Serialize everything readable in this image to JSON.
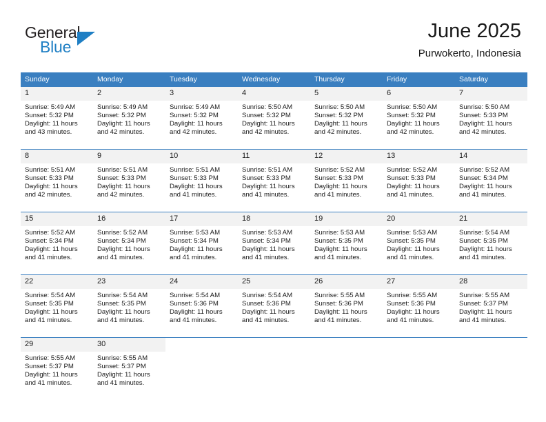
{
  "brand": {
    "line1": "General",
    "line2": "Blue",
    "flag_icon": "triangle-flag-icon",
    "accent_color": "#1f7fc4"
  },
  "header": {
    "title": "June 2025",
    "location": "Purwokerto, Indonesia"
  },
  "calendar": {
    "header_bg": "#3a7fc0",
    "daynum_bg": "#f2f2f2",
    "weekday_headers": [
      "Sunday",
      "Monday",
      "Tuesday",
      "Wednesday",
      "Thursday",
      "Friday",
      "Saturday"
    ],
    "weeks": [
      [
        {
          "day": "1",
          "sunrise": "Sunrise: 5:49 AM",
          "sunset": "Sunset: 5:32 PM",
          "daylight1": "Daylight: 11 hours",
          "daylight2": "and 43 minutes."
        },
        {
          "day": "2",
          "sunrise": "Sunrise: 5:49 AM",
          "sunset": "Sunset: 5:32 PM",
          "daylight1": "Daylight: 11 hours",
          "daylight2": "and 42 minutes."
        },
        {
          "day": "3",
          "sunrise": "Sunrise: 5:49 AM",
          "sunset": "Sunset: 5:32 PM",
          "daylight1": "Daylight: 11 hours",
          "daylight2": "and 42 minutes."
        },
        {
          "day": "4",
          "sunrise": "Sunrise: 5:50 AM",
          "sunset": "Sunset: 5:32 PM",
          "daylight1": "Daylight: 11 hours",
          "daylight2": "and 42 minutes."
        },
        {
          "day": "5",
          "sunrise": "Sunrise: 5:50 AM",
          "sunset": "Sunset: 5:32 PM",
          "daylight1": "Daylight: 11 hours",
          "daylight2": "and 42 minutes."
        },
        {
          "day": "6",
          "sunrise": "Sunrise: 5:50 AM",
          "sunset": "Sunset: 5:32 PM",
          "daylight1": "Daylight: 11 hours",
          "daylight2": "and 42 minutes."
        },
        {
          "day": "7",
          "sunrise": "Sunrise: 5:50 AM",
          "sunset": "Sunset: 5:33 PM",
          "daylight1": "Daylight: 11 hours",
          "daylight2": "and 42 minutes."
        }
      ],
      [
        {
          "day": "8",
          "sunrise": "Sunrise: 5:51 AM",
          "sunset": "Sunset: 5:33 PM",
          "daylight1": "Daylight: 11 hours",
          "daylight2": "and 42 minutes."
        },
        {
          "day": "9",
          "sunrise": "Sunrise: 5:51 AM",
          "sunset": "Sunset: 5:33 PM",
          "daylight1": "Daylight: 11 hours",
          "daylight2": "and 42 minutes."
        },
        {
          "day": "10",
          "sunrise": "Sunrise: 5:51 AM",
          "sunset": "Sunset: 5:33 PM",
          "daylight1": "Daylight: 11 hours",
          "daylight2": "and 41 minutes."
        },
        {
          "day": "11",
          "sunrise": "Sunrise: 5:51 AM",
          "sunset": "Sunset: 5:33 PM",
          "daylight1": "Daylight: 11 hours",
          "daylight2": "and 41 minutes."
        },
        {
          "day": "12",
          "sunrise": "Sunrise: 5:52 AM",
          "sunset": "Sunset: 5:33 PM",
          "daylight1": "Daylight: 11 hours",
          "daylight2": "and 41 minutes."
        },
        {
          "day": "13",
          "sunrise": "Sunrise: 5:52 AM",
          "sunset": "Sunset: 5:33 PM",
          "daylight1": "Daylight: 11 hours",
          "daylight2": "and 41 minutes."
        },
        {
          "day": "14",
          "sunrise": "Sunrise: 5:52 AM",
          "sunset": "Sunset: 5:34 PM",
          "daylight1": "Daylight: 11 hours",
          "daylight2": "and 41 minutes."
        }
      ],
      [
        {
          "day": "15",
          "sunrise": "Sunrise: 5:52 AM",
          "sunset": "Sunset: 5:34 PM",
          "daylight1": "Daylight: 11 hours",
          "daylight2": "and 41 minutes."
        },
        {
          "day": "16",
          "sunrise": "Sunrise: 5:52 AM",
          "sunset": "Sunset: 5:34 PM",
          "daylight1": "Daylight: 11 hours",
          "daylight2": "and 41 minutes."
        },
        {
          "day": "17",
          "sunrise": "Sunrise: 5:53 AM",
          "sunset": "Sunset: 5:34 PM",
          "daylight1": "Daylight: 11 hours",
          "daylight2": "and 41 minutes."
        },
        {
          "day": "18",
          "sunrise": "Sunrise: 5:53 AM",
          "sunset": "Sunset: 5:34 PM",
          "daylight1": "Daylight: 11 hours",
          "daylight2": "and 41 minutes."
        },
        {
          "day": "19",
          "sunrise": "Sunrise: 5:53 AM",
          "sunset": "Sunset: 5:35 PM",
          "daylight1": "Daylight: 11 hours",
          "daylight2": "and 41 minutes."
        },
        {
          "day": "20",
          "sunrise": "Sunrise: 5:53 AM",
          "sunset": "Sunset: 5:35 PM",
          "daylight1": "Daylight: 11 hours",
          "daylight2": "and 41 minutes."
        },
        {
          "day": "21",
          "sunrise": "Sunrise: 5:54 AM",
          "sunset": "Sunset: 5:35 PM",
          "daylight1": "Daylight: 11 hours",
          "daylight2": "and 41 minutes."
        }
      ],
      [
        {
          "day": "22",
          "sunrise": "Sunrise: 5:54 AM",
          "sunset": "Sunset: 5:35 PM",
          "daylight1": "Daylight: 11 hours",
          "daylight2": "and 41 minutes."
        },
        {
          "day": "23",
          "sunrise": "Sunrise: 5:54 AM",
          "sunset": "Sunset: 5:35 PM",
          "daylight1": "Daylight: 11 hours",
          "daylight2": "and 41 minutes."
        },
        {
          "day": "24",
          "sunrise": "Sunrise: 5:54 AM",
          "sunset": "Sunset: 5:36 PM",
          "daylight1": "Daylight: 11 hours",
          "daylight2": "and 41 minutes."
        },
        {
          "day": "25",
          "sunrise": "Sunrise: 5:54 AM",
          "sunset": "Sunset: 5:36 PM",
          "daylight1": "Daylight: 11 hours",
          "daylight2": "and 41 minutes."
        },
        {
          "day": "26",
          "sunrise": "Sunrise: 5:55 AM",
          "sunset": "Sunset: 5:36 PM",
          "daylight1": "Daylight: 11 hours",
          "daylight2": "and 41 minutes."
        },
        {
          "day": "27",
          "sunrise": "Sunrise: 5:55 AM",
          "sunset": "Sunset: 5:36 PM",
          "daylight1": "Daylight: 11 hours",
          "daylight2": "and 41 minutes."
        },
        {
          "day": "28",
          "sunrise": "Sunrise: 5:55 AM",
          "sunset": "Sunset: 5:37 PM",
          "daylight1": "Daylight: 11 hours",
          "daylight2": "and 41 minutes."
        }
      ],
      [
        {
          "day": "29",
          "sunrise": "Sunrise: 5:55 AM",
          "sunset": "Sunset: 5:37 PM",
          "daylight1": "Daylight: 11 hours",
          "daylight2": "and 41 minutes."
        },
        {
          "day": "30",
          "sunrise": "Sunrise: 5:55 AM",
          "sunset": "Sunset: 5:37 PM",
          "daylight1": "Daylight: 11 hours",
          "daylight2": "and 41 minutes."
        },
        {
          "day": "",
          "sunrise": "",
          "sunset": "",
          "daylight1": "",
          "daylight2": ""
        },
        {
          "day": "",
          "sunrise": "",
          "sunset": "",
          "daylight1": "",
          "daylight2": ""
        },
        {
          "day": "",
          "sunrise": "",
          "sunset": "",
          "daylight1": "",
          "daylight2": ""
        },
        {
          "day": "",
          "sunrise": "",
          "sunset": "",
          "daylight1": "",
          "daylight2": ""
        },
        {
          "day": "",
          "sunrise": "",
          "sunset": "",
          "daylight1": "",
          "daylight2": ""
        }
      ]
    ]
  }
}
